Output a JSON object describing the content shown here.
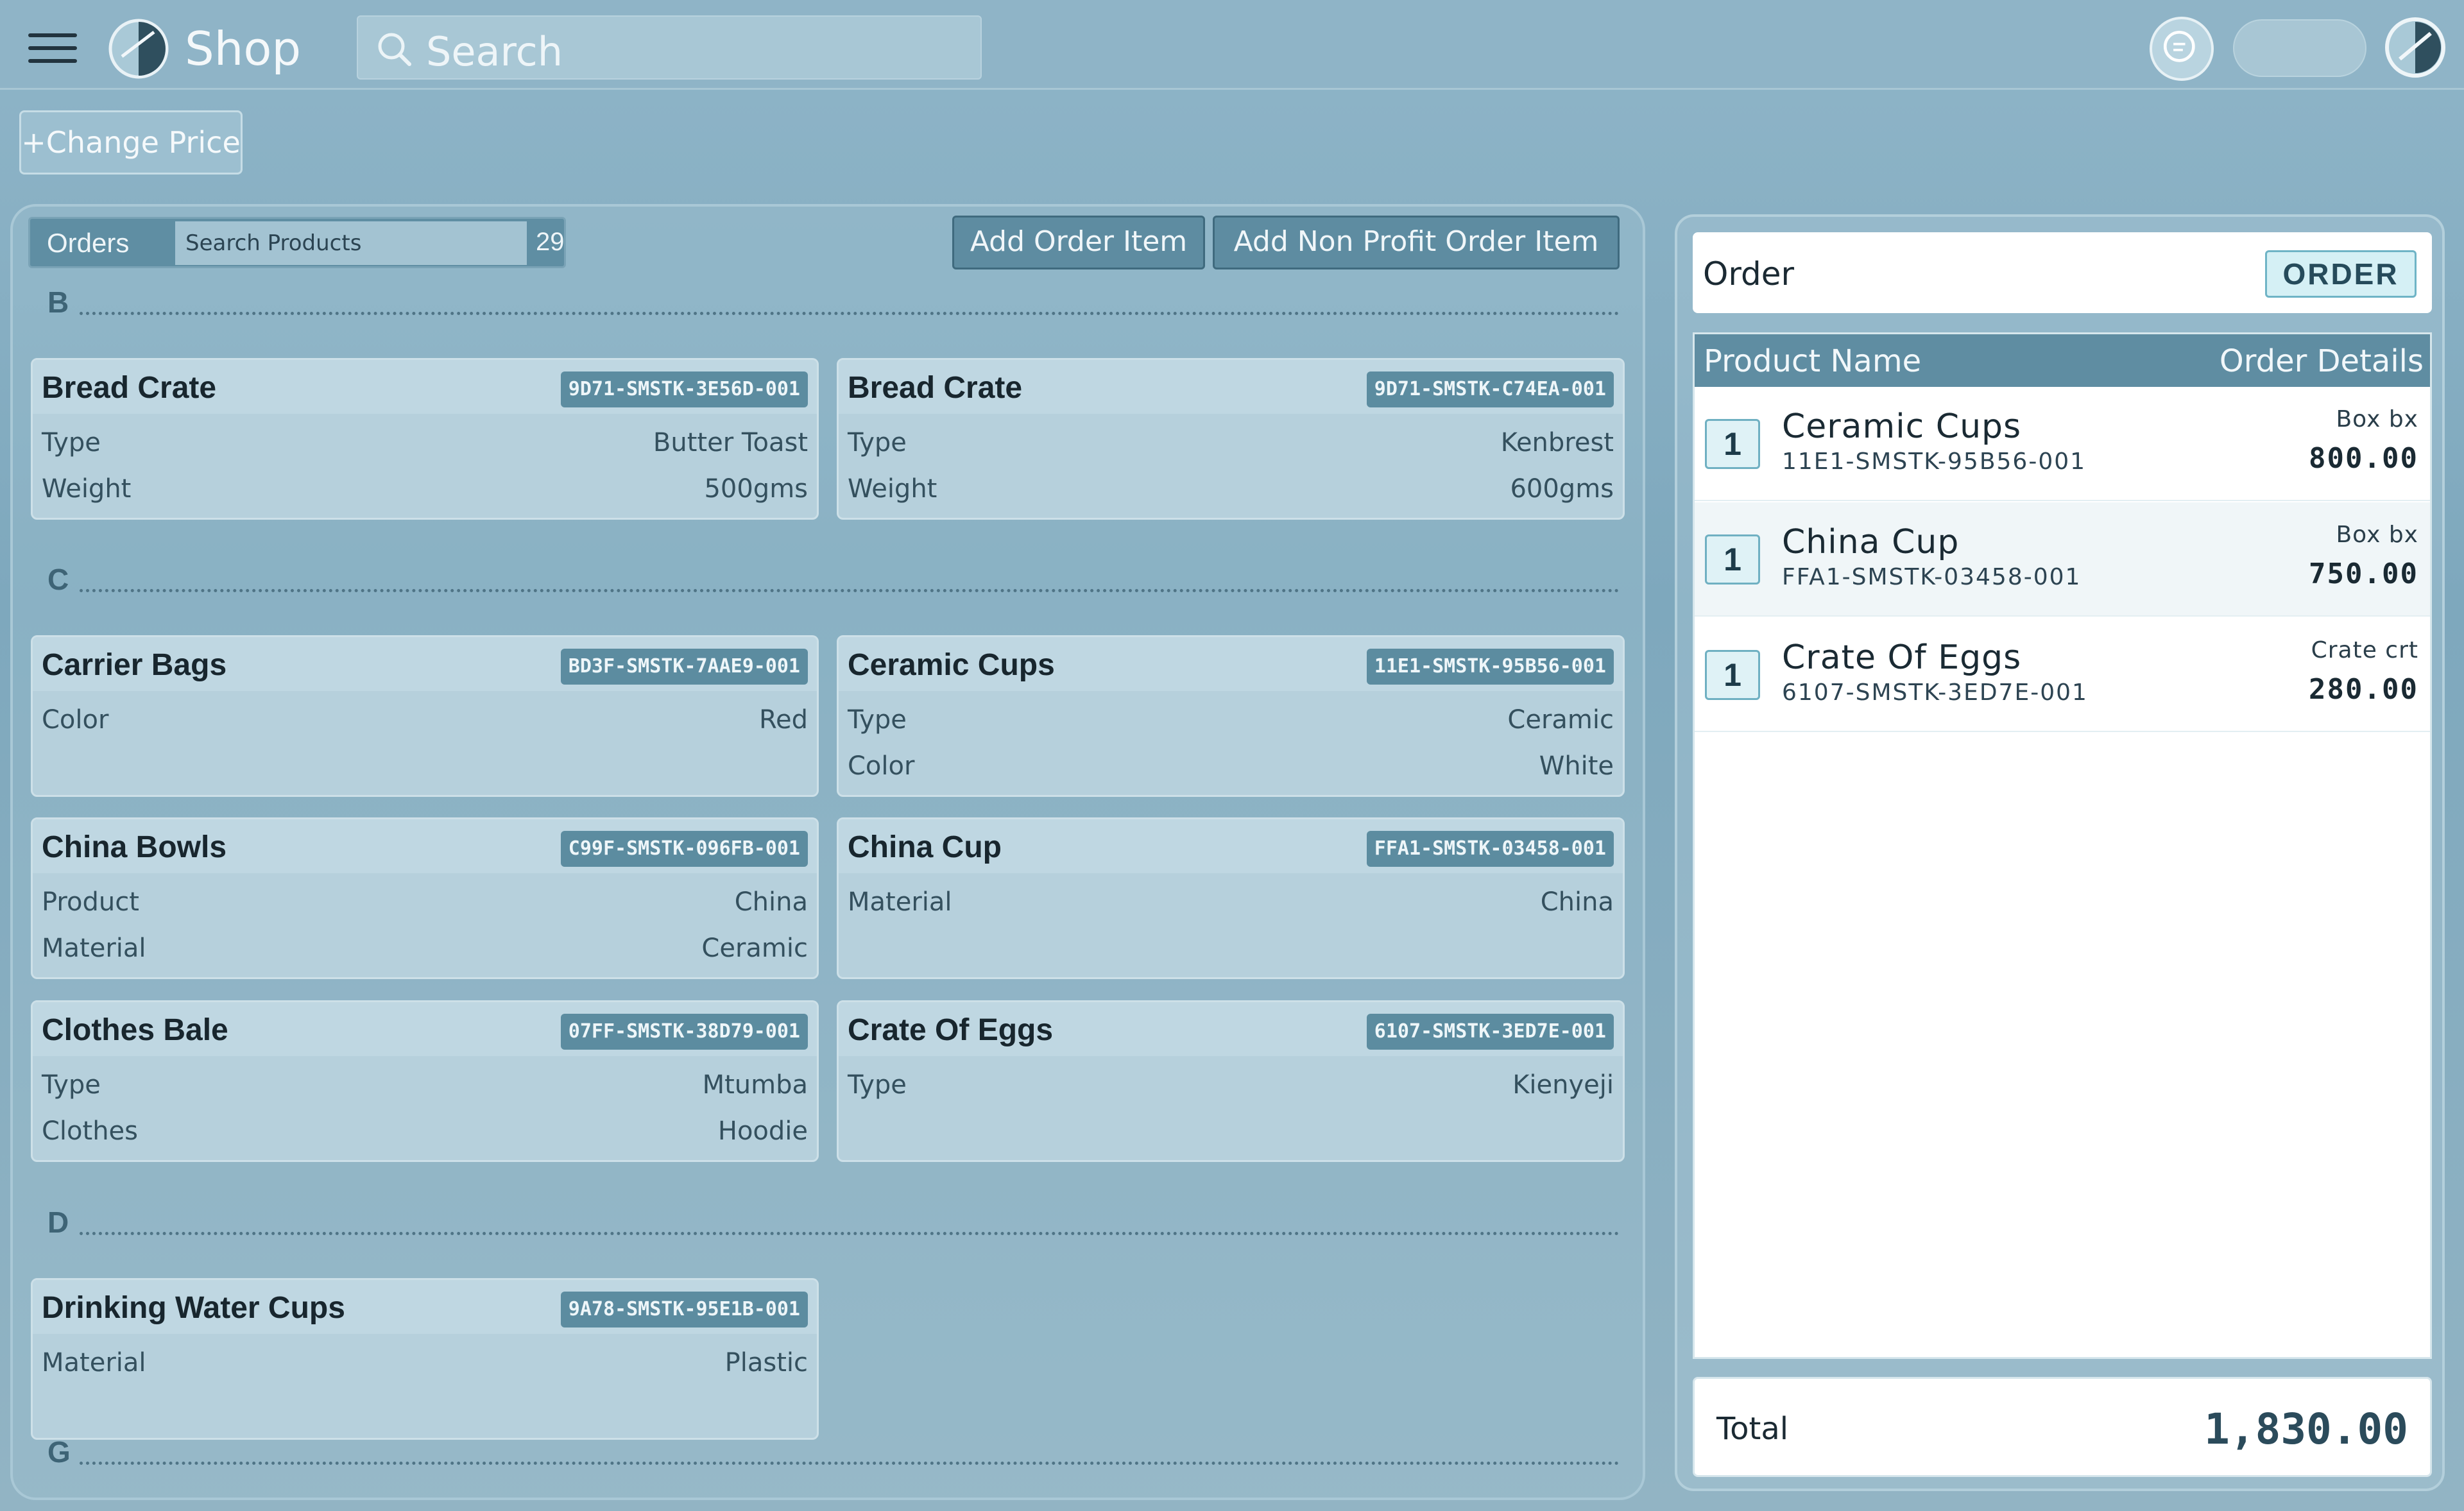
{
  "app": {
    "brand": "Shop"
  },
  "search": {
    "placeholder": "Search"
  },
  "toolbar": {
    "change_price_label": "+Change Price"
  },
  "orders_panel": {
    "title": "Orders",
    "search_placeholder": "Search Products",
    "count": "29",
    "add_order_item_label": "Add Order Item",
    "add_non_profit_label": "Add Non Profit Order Item"
  },
  "sections": [
    "B",
    "C",
    "D",
    "G"
  ],
  "products": [
    {
      "name": "Bread Crate",
      "sku": "9D71-SMSTK-3E56D-001",
      "attrs": [
        {
          "k": "Type",
          "v": "Butter Toast"
        },
        {
          "k": "Weight",
          "v": "500gms"
        }
      ]
    },
    {
      "name": "Bread Crate",
      "sku": "9D71-SMSTK-C74EA-001",
      "attrs": [
        {
          "k": "Type",
          "v": "Kenbrest"
        },
        {
          "k": "Weight",
          "v": "600gms"
        }
      ]
    },
    {
      "name": "Carrier Bags",
      "sku": "BD3F-SMSTK-7AAE9-001",
      "attrs": [
        {
          "k": "Color",
          "v": "Red"
        }
      ]
    },
    {
      "name": "Ceramic Cups",
      "sku": "11E1-SMSTK-95B56-001",
      "attrs": [
        {
          "k": "Type",
          "v": "Ceramic"
        },
        {
          "k": "Color",
          "v": "White"
        }
      ]
    },
    {
      "name": "China Bowls",
      "sku": "C99F-SMSTK-096FB-001",
      "attrs": [
        {
          "k": "Product",
          "v": "China"
        },
        {
          "k": "Material",
          "v": "Ceramic"
        }
      ]
    },
    {
      "name": "China Cup",
      "sku": "FFA1-SMSTK-03458-001",
      "attrs": [
        {
          "k": "Material",
          "v": "China"
        }
      ]
    },
    {
      "name": "Clothes Bale",
      "sku": "07FF-SMSTK-38D79-001",
      "attrs": [
        {
          "k": "Type",
          "v": "Mtumba"
        },
        {
          "k": "Clothes",
          "v": "Hoodie"
        }
      ]
    },
    {
      "name": "Crate Of Eggs",
      "sku": "6107-SMSTK-3ED7E-001",
      "attrs": [
        {
          "k": "Type",
          "v": "Kienyeji"
        }
      ]
    },
    {
      "name": "Drinking Water Cups",
      "sku": "9A78-SMSTK-95E1B-001",
      "attrs": [
        {
          "k": "Material",
          "v": "Plastic"
        }
      ]
    }
  ],
  "order": {
    "title": "Order",
    "badge": "ORDER",
    "col_product": "Product Name",
    "col_details": "Order Details",
    "items": [
      {
        "qty": "1",
        "name": "Ceramic Cups",
        "sku": "11E1-SMSTK-95B56-001",
        "unit": "Box bx",
        "price": "800.00"
      },
      {
        "qty": "1",
        "name": "China Cup",
        "sku": "FFA1-SMSTK-03458-001",
        "unit": "Box bx",
        "price": "750.00"
      },
      {
        "qty": "1",
        "name": "Crate Of Eggs",
        "sku": "6107-SMSTK-3ED7E-001",
        "unit": "Crate crt",
        "price": "280.00"
      }
    ],
    "total_label": "Total",
    "total_value": "1,830.00"
  },
  "colors": {
    "accent": "#5f8da2",
    "background": "#8fb4c7",
    "badge_border": "#6fb4c6"
  }
}
